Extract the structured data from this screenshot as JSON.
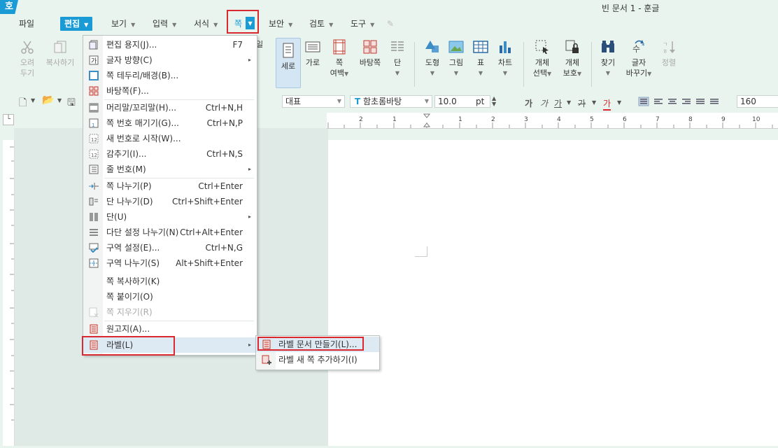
{
  "app": {
    "logo": "호",
    "title": "빈 문서 1 - 훈글"
  },
  "menubar": {
    "file": "파일",
    "edit": "편집",
    "view": "보기",
    "insert": "입력",
    "format": "서식",
    "page": "쪽",
    "security": "보안",
    "review": "검토",
    "tools": "도구"
  },
  "toolbar": {
    "cut": [
      "오려",
      "두기"
    ],
    "copy": "복사하기",
    "portrait": "세로",
    "landscape": "가로",
    "margin": [
      "쪽",
      "여백"
    ],
    "background": "바탕쪽",
    "column": "단",
    "shape": "도형",
    "picture": "그림",
    "table": "표",
    "chart": "차트",
    "obj_select": [
      "개체",
      "선택"
    ],
    "obj_protect": [
      "개체",
      "보호"
    ],
    "find": "찾기",
    "replace": [
      "글자",
      "바꾸기"
    ],
    "sort": "정렬"
  },
  "formatbar": {
    "style": "대표",
    "font": "함초롬바탕",
    "size": "10.0",
    "unit": "pt",
    "bold": "가",
    "italic": "가",
    "underline": "가",
    "strike": "가",
    "color": "가",
    "line_spacing": "160"
  },
  "ruler": {
    "marks": [
      "2",
      "1",
      "1",
      "2",
      "3",
      "4",
      "5",
      "6",
      "7",
      "8",
      "9",
      "10"
    ]
  },
  "dropdown": {
    "items": [
      {
        "label": "편집 용지(J)...",
        "shortcut": "F7"
      },
      {
        "label": "글자 방향(C)",
        "shortcut": "",
        "submenu": true
      },
      {
        "label": "쪽 테두리/배경(B)...",
        "shortcut": ""
      },
      {
        "label": "바탕쪽(F)...",
        "shortcut": ""
      },
      {
        "label": "머리말/꼬리말(H)...",
        "shortcut": "Ctrl+N,H"
      },
      {
        "label": "쪽 번호 매기기(G)...",
        "shortcut": "Ctrl+N,P"
      },
      {
        "label": "새 번호로 시작(W)...",
        "shortcut": ""
      },
      {
        "label": "감추기(I)...",
        "shortcut": "Ctrl+N,S"
      },
      {
        "label": "줄 번호(M)",
        "shortcut": "",
        "submenu": true
      },
      {
        "label": "쪽 나누기(P)",
        "shortcut": "Ctrl+Enter"
      },
      {
        "label": "단 나누기(D)",
        "shortcut": "Ctrl+Shift+Enter"
      },
      {
        "label": "단(U)",
        "shortcut": "",
        "submenu": true
      },
      {
        "label": "다단 설정 나누기(N)",
        "shortcut": "Ctrl+Alt+Enter"
      },
      {
        "label": "구역 설정(E)...",
        "shortcut": "Ctrl+N,G"
      },
      {
        "label": "구역 나누기(S)",
        "shortcut": "Alt+Shift+Enter"
      },
      {
        "label": "쪽 복사하기(K)",
        "shortcut": ""
      },
      {
        "label": "쪽 붙이기(O)",
        "shortcut": ""
      },
      {
        "label": "쪽 지우기(R)",
        "shortcut": "",
        "disabled": true
      },
      {
        "label": "원고지(A)...",
        "shortcut": ""
      },
      {
        "label": "라벨(L)",
        "shortcut": "",
        "submenu": true,
        "highlighted": true
      }
    ]
  },
  "submenu": {
    "items": [
      {
        "label": "라벨 문서 만들기(L)...",
        "highlighted": true
      },
      {
        "label": "라벨 새 쪽 추가하기(I)"
      }
    ]
  },
  "colors": {
    "accent": "#1a9bd6",
    "highlight_box": "#d9282f",
    "background": "#e9f4ef"
  }
}
